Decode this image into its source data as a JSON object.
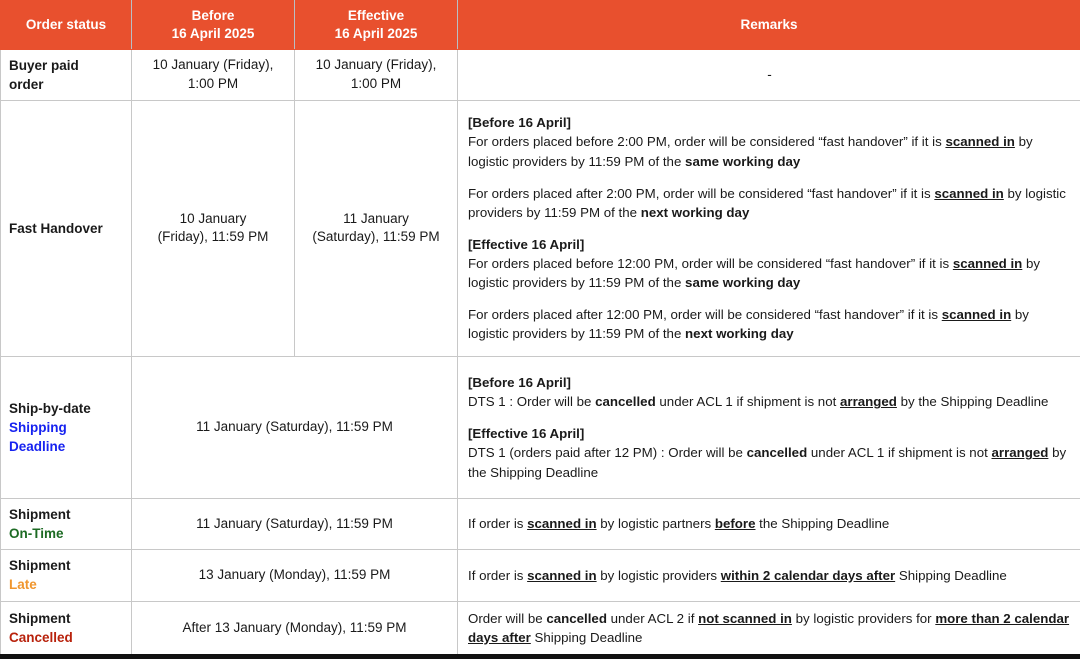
{
  "table": {
    "headers": {
      "status": "Order status",
      "before_line1": "Before",
      "before_line2": "16 April 2025",
      "effective_line1": "Effective",
      "effective_line2": "16 April 2025",
      "remarks": "Remarks"
    },
    "colors": {
      "header_bg": "#E8502E",
      "header_text": "#FFFFFF",
      "shipping_deadline": "#1622F0",
      "on_time": "#1D6B24",
      "late": "#F0962E",
      "cancelled": "#B8220C",
      "grid_line": "#C8C8C8",
      "bottom_border": "#111111"
    },
    "rows": [
      {
        "id": "buyer-paid-order",
        "status_main": "Buyer paid",
        "status_main2": "order",
        "status_sub": "",
        "before": "10 January (Friday),\n1:00 PM",
        "before_line1": "10 January (Friday),",
        "before_line2": "1:00 PM",
        "effective_line1": "10 January (Friday),",
        "effective_line2": "1:00 PM",
        "remarks_text": "-"
      },
      {
        "id": "fast-handover",
        "status_main": "Fast Handover",
        "status_sub": "",
        "before_line1": "10 January",
        "before_line2": "(Friday), 11:59 PM",
        "effective_line1": "11 January",
        "effective_line2": "(Saturday), 11:59 PM",
        "remarks": {
          "before_heading": "[Before 16 April]",
          "before_p1_a": "For orders placed before 2:00 PM, order will be considered “fast handover” if it is ",
          "before_p1_scanned": "scanned in",
          "before_p1_b": " by logistic providers by 11:59 PM of the ",
          "before_p1_bold": "same working day",
          "before_p2_a": "For orders placed after 2:00 PM, order will be considered “fast handover” if it is ",
          "before_p2_scanned": "scanned in",
          "before_p2_b": " by logistic providers by 11:59 PM of the ",
          "before_p2_bold": "next working day",
          "effective_heading": "[Effective 16 April]",
          "eff_p1_a": "For orders placed before 12:00 PM, order will be considered “fast handover” if it is ",
          "eff_p1_scanned": "scanned in",
          "eff_p1_b": " by logistic providers by 11:59 PM of the ",
          "eff_p1_bold": "same working day",
          "eff_p2_a": "For orders placed after 12:00 PM, order will be considered “fast handover” if it is ",
          "eff_p2_scanned": "scanned in",
          "eff_p2_b": " by logistic providers by 11:59 PM of the ",
          "eff_p2_bold": "next working day"
        }
      },
      {
        "id": "ship-by-date",
        "status_main": "Ship-by-date",
        "status_sub_line1": "Shipping",
        "status_sub_line2": "Deadline",
        "date_merged": "11 January (Saturday), 11:59 PM",
        "remarks": {
          "before_heading": "[Before 16 April]",
          "before_a": "DTS 1 : Order will be ",
          "before_cancelled": "cancelled",
          "before_b": " under ACL 1 if shipment is not ",
          "before_arranged": "arranged",
          "before_c": " by the Shipping Deadline",
          "effective_heading": "[Effective 16 April]",
          "eff_a": "DTS 1 (orders paid after 12 PM) : Order will be ",
          "eff_cancelled": "cancelled",
          "eff_b": " under ACL 1 if shipment is not ",
          "eff_arranged": "arranged",
          "eff_c": " by the Shipping Deadline"
        }
      },
      {
        "id": "shipment-on-time",
        "status_main": "Shipment",
        "status_sub": "On-Time",
        "date_merged": "11 January (Saturday), 11:59 PM",
        "remarks": {
          "a": "If order is ",
          "scanned": "scanned in",
          "b": " by logistic partners ",
          "before_u": "before",
          "c": " the Shipping Deadline"
        }
      },
      {
        "id": "shipment-late",
        "status_main": "Shipment",
        "status_sub": "Late",
        "date_merged": "13 January (Monday), 11:59 PM",
        "remarks": {
          "a": "If order is ",
          "scanned": "scanned in",
          "b": " by logistic providers ",
          "within_u": "within 2 calendar days after",
          "c": " Shipping Deadline"
        }
      },
      {
        "id": "shipment-cancelled",
        "status_main": "Shipment",
        "status_sub": "Cancelled",
        "date_merged": "After 13 January (Monday), 11:59 PM",
        "remarks": {
          "a": "Order will be ",
          "cancelled_b": "cancelled",
          "b": " under ACL 2 if ",
          "not_scanned_u": "not scanned in",
          "c": " by logistic providers for ",
          "more_than_u": "more than 2 calendar days after",
          "d": " Shipping Deadline"
        }
      }
    ]
  }
}
